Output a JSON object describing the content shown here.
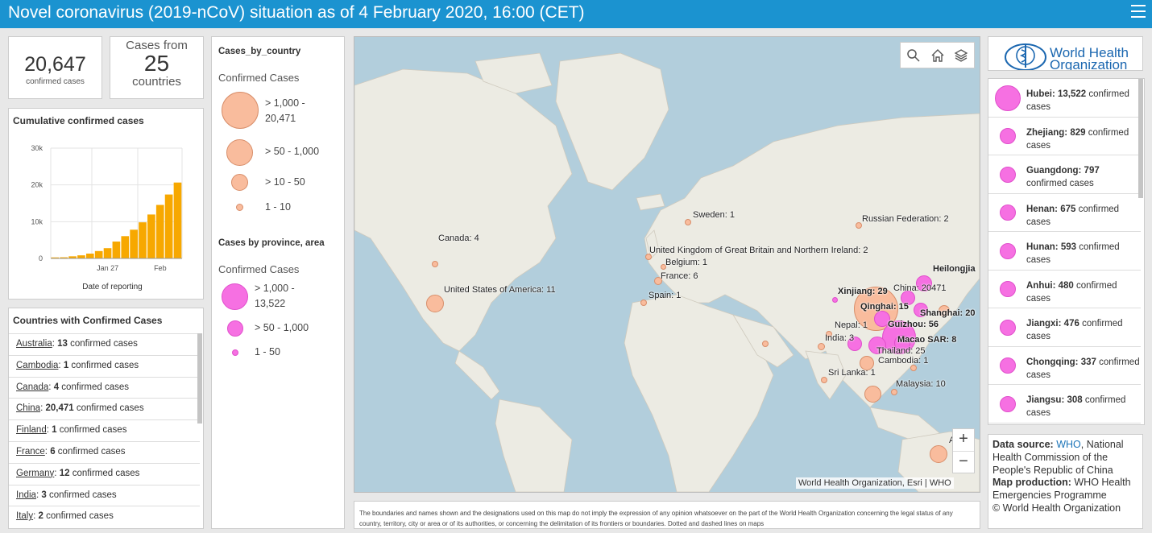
{
  "header": {
    "title": "Novel coronavirus (2019-nCoV) situation as of 4 February 2020, 16:00 (CET)"
  },
  "total": {
    "value": "20,647",
    "label": "confirmed cases"
  },
  "countries_count": {
    "line1": "Cases from",
    "value": "25",
    "line2": "countries"
  },
  "chart": {
    "title": "Cumulative confirmed cases",
    "xlabel": "Date of reporting"
  },
  "chart_data": {
    "type": "bar",
    "title": "Cumulative confirmed cases",
    "xlabel": "Date of reporting",
    "ylabel": "",
    "ylim": [
      0,
      30000
    ],
    "yticks": [
      "0",
      "10k",
      "20k",
      "30k"
    ],
    "x_tick_labels": [
      {
        "label": "Jan 27",
        "index": 6
      },
      {
        "label": "Feb",
        "index": 12
      }
    ],
    "values": [
      282,
      314,
      581,
      846,
      1320,
      2014,
      2798,
      4593,
      6065,
      7818,
      9826,
      11953,
      14557,
      17391,
      20647
    ],
    "color": "#f7a800",
    "grid": true
  },
  "country_list": {
    "title": "Countries with Confirmed Cases",
    "rows": [
      {
        "name": "Australia",
        "count": "13",
        "suffix": "confirmed cases"
      },
      {
        "name": "Cambodia",
        "count": "1",
        "suffix": "confirmed cases"
      },
      {
        "name": "Canada",
        "count": "4",
        "suffix": "confirmed cases"
      },
      {
        "name": "China",
        "count": "20,471",
        "suffix": "confirmed cases"
      },
      {
        "name": "Finland",
        "count": "1",
        "suffix": "confirmed cases"
      },
      {
        "name": "France",
        "count": "6",
        "suffix": "confirmed cases"
      },
      {
        "name": "Germany",
        "count": "12",
        "suffix": "confirmed cases"
      },
      {
        "name": "India",
        "count": "3",
        "suffix": "confirmed cases"
      },
      {
        "name": "Italy",
        "count": "2",
        "suffix": "confirmed cases"
      }
    ]
  },
  "legend": {
    "section1_title": "Cases_by_country",
    "section1_sub": "Confirmed Cases",
    "s1_items": [
      "> 1,000 - 20,471",
      "> 50 - 1,000",
      "> 10 - 50",
      "1 - 10"
    ],
    "section2_title": "Cases by province, area",
    "section2_sub": "Confirmed Cases",
    "s2_items": [
      "> 1,000 - 13,522",
      "> 50 - 1,000",
      "1 - 50"
    ]
  },
  "map": {
    "labels": [
      {
        "text": "Canada: 4",
        "bold": false
      },
      {
        "text": "United States of America: 11",
        "bold": false
      },
      {
        "text": "Sweden: 1",
        "bold": false
      },
      {
        "text": "Russian Federation: 2",
        "bold": false
      },
      {
        "text": "United Kingdom of Great Britain and Northern Ireland: 2",
        "bold": false
      },
      {
        "text": "Belgium: 1",
        "bold": false
      },
      {
        "text": "France: 6",
        "bold": false
      },
      {
        "text": "Spain: 1",
        "bold": false
      },
      {
        "text": "Heilongjia",
        "bold": true
      },
      {
        "text": "Xinjiang: 29",
        "bold": true
      },
      {
        "text": "China: 20471",
        "bold": false
      },
      {
        "text": "Qinghai: 15",
        "bold": true
      },
      {
        "text": "Shanghai: 20",
        "bold": true
      },
      {
        "text": "Nepal: 1",
        "bold": false
      },
      {
        "text": "Guizhou: 56",
        "bold": true
      },
      {
        "text": "India: 3",
        "bold": false
      },
      {
        "text": "Macao SAR: 8",
        "bold": true
      },
      {
        "text": "Thailand: 25",
        "bold": false
      },
      {
        "text": "Cambodia: 1",
        "bold": false
      },
      {
        "text": "Sri Lanka: 1",
        "bold": false
      },
      {
        "text": "Malaysia: 10",
        "bold": false
      },
      {
        "text": "A",
        "bold": false
      }
    ],
    "zoom_in": "+",
    "zoom_out": "−",
    "attribution": "World Health Organization, Esri | WHO",
    "tools": [
      "search-icon",
      "home-icon",
      "layers-icon"
    ]
  },
  "disclaimer": "The boundaries and names shown and the designations used on this map do not imply the expression of any opinion whatsoever on the part of the World Health Organization concerning the legal status of any country, territory, city or area or of its authorities, or concerning the delimitation of its frontiers or boundaries. Dotted and dashed lines on maps",
  "logo": {
    "text_line1": "World Health",
    "text_line2": "Organization"
  },
  "provinces": [
    {
      "name": "Hubei:",
      "count": "13,522",
      "suffix": "confirmed cases"
    },
    {
      "name": "Zhejiang:",
      "count": "829",
      "suffix": "confirmed cases"
    },
    {
      "name": "Guangdong:",
      "count": "797",
      "suffix": "confirmed cases"
    },
    {
      "name": "Henan:",
      "count": "675",
      "suffix": "confirmed cases"
    },
    {
      "name": "Hunan:",
      "count": "593",
      "suffix": "confirmed cases"
    },
    {
      "name": "Anhui:",
      "count": "480",
      "suffix": "confirmed cases"
    },
    {
      "name": "Jiangxi:",
      "count": "476",
      "suffix": "confirmed cases"
    },
    {
      "name": "Chongqing:",
      "count": "337",
      "suffix": "confirmed cases"
    },
    {
      "name": "Jiangsu:",
      "count": "308",
      "suffix": "confirmed cases"
    }
  ],
  "source": {
    "ds_label": "Data source:",
    "ds_link": "WHO",
    "ds_text": ", National Health Commission of the People's Republic of China",
    "mp_label": "Map production:",
    "mp_text": " WHO Health Emergencies Programme",
    "copyright": "© World Health Organization"
  },
  "colors": {
    "header": "#1b93d0",
    "bar": "#f7a800",
    "country_bubble": "#f9bc9d",
    "province_bubble": "#f670e2"
  }
}
